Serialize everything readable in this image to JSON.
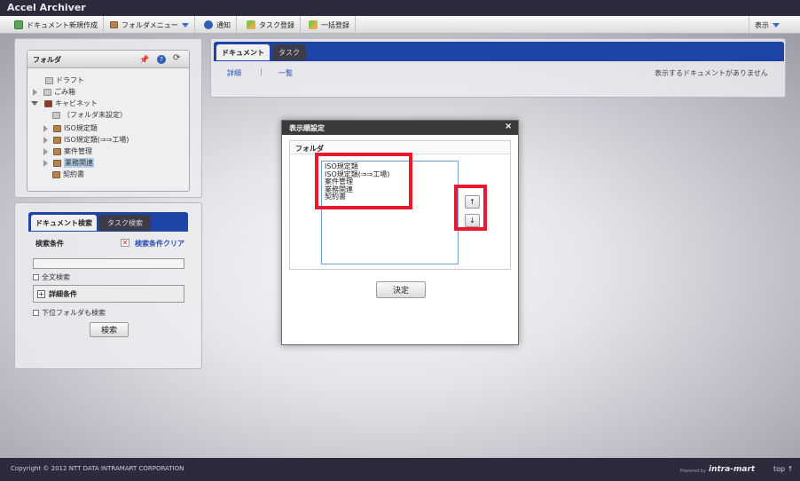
{
  "app": {
    "title": "Accel Archiver"
  },
  "menubar": {
    "items": [
      {
        "label": "ドキュメント新規作成",
        "icon": "new-document-icon"
      },
      {
        "label": "フォルダメニュー",
        "icon": "folder-icon"
      },
      {
        "label": "通知",
        "icon": "info-icon"
      },
      {
        "label": "タスク登録",
        "icon": "task-register-icon"
      },
      {
        "label": "一括登録",
        "icon": "bulk-register-icon"
      }
    ],
    "display_label": "表示"
  },
  "folder_panel": {
    "title": "フォルダ",
    "tree": [
      {
        "label": "ドラフト"
      },
      {
        "label": "ごみ箱"
      },
      {
        "label": "キャビネット"
      },
      {
        "label": "（フォルダ未設定）"
      },
      {
        "label": "ISO規定類"
      },
      {
        "label": "ISO規定類(⇒⇒工場)"
      },
      {
        "label": "案件管理"
      },
      {
        "label": "業務関連"
      },
      {
        "label": "契約書"
      }
    ]
  },
  "search_panel": {
    "tabs": [
      "ドキュメント検索",
      "タスク検索"
    ],
    "condition_label": "検索条件",
    "clear_label": "検索条件クリア",
    "input_value": "",
    "fulltext_label": "全文検索",
    "detail_label": "詳細条件",
    "subfolder_label": "下位フォルダも検索",
    "search_button": "検索"
  },
  "doc_panel": {
    "tabs": [
      "ドキュメント",
      "タスク"
    ],
    "links": [
      "詳細",
      "一覧"
    ],
    "empty_message": "表示するドキュメントがありません"
  },
  "dialog": {
    "title": "表示順設定",
    "close_glyph": "×",
    "section_label": "フォルダ",
    "list_items": [
      "ISO規定類",
      "ISO規定類(⇒⇒工場)",
      "案件管理",
      "業務関連",
      "契約書"
    ],
    "up_glyph": "↑",
    "down_glyph": "↓",
    "confirm_button": "決定"
  },
  "footer": {
    "copyright": "Copyright © 2012 NTT DATA INTRAMART CORPORATION",
    "powered_by": "Powered by",
    "brand": "intra-mart",
    "top_link": "top ↑"
  },
  "colors": {
    "header_bg": "#2b2b3b",
    "tab_blue": "#1e44a8",
    "highlight_red": "#e8192c",
    "link_blue": "#2a4fb5"
  }
}
